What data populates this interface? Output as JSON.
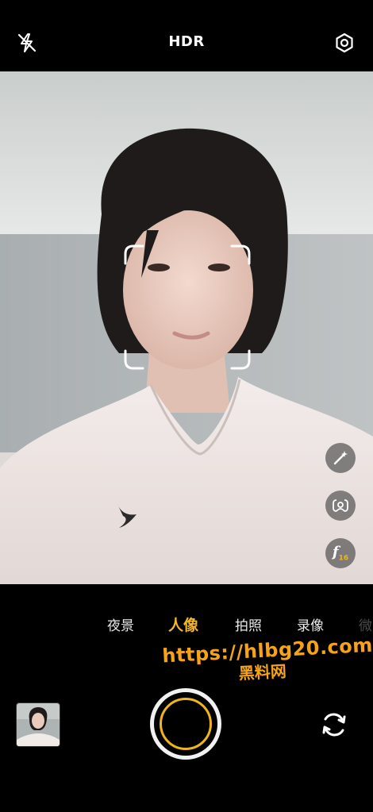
{
  "top_bar": {
    "flash_icon": "flash-off-icon",
    "hdr_label": "HDR",
    "settings_icon": "gear-icon"
  },
  "side_controls": [
    {
      "icon": "magic-wand-icon"
    },
    {
      "icon": "portrait-lighting-icon"
    },
    {
      "icon": "aperture-icon",
      "label": "f",
      "value": "16"
    }
  ],
  "modes": [
    {
      "label": "夜景"
    },
    {
      "label": "人像",
      "active": true
    },
    {
      "label": "拍照"
    },
    {
      "label": "录像"
    },
    {
      "label": "微"
    }
  ],
  "watermark": {
    "url": "https://hlbg20.com",
    "cn": "黑料网"
  },
  "bottom": {
    "thumbnail": "gallery-thumbnail",
    "shutter": "shutter-button",
    "switch_camera_icon": "camera-switch-icon"
  },
  "colors": {
    "accent": "#f3b72a",
    "watermark": "#f7a317",
    "background": "#000000"
  }
}
